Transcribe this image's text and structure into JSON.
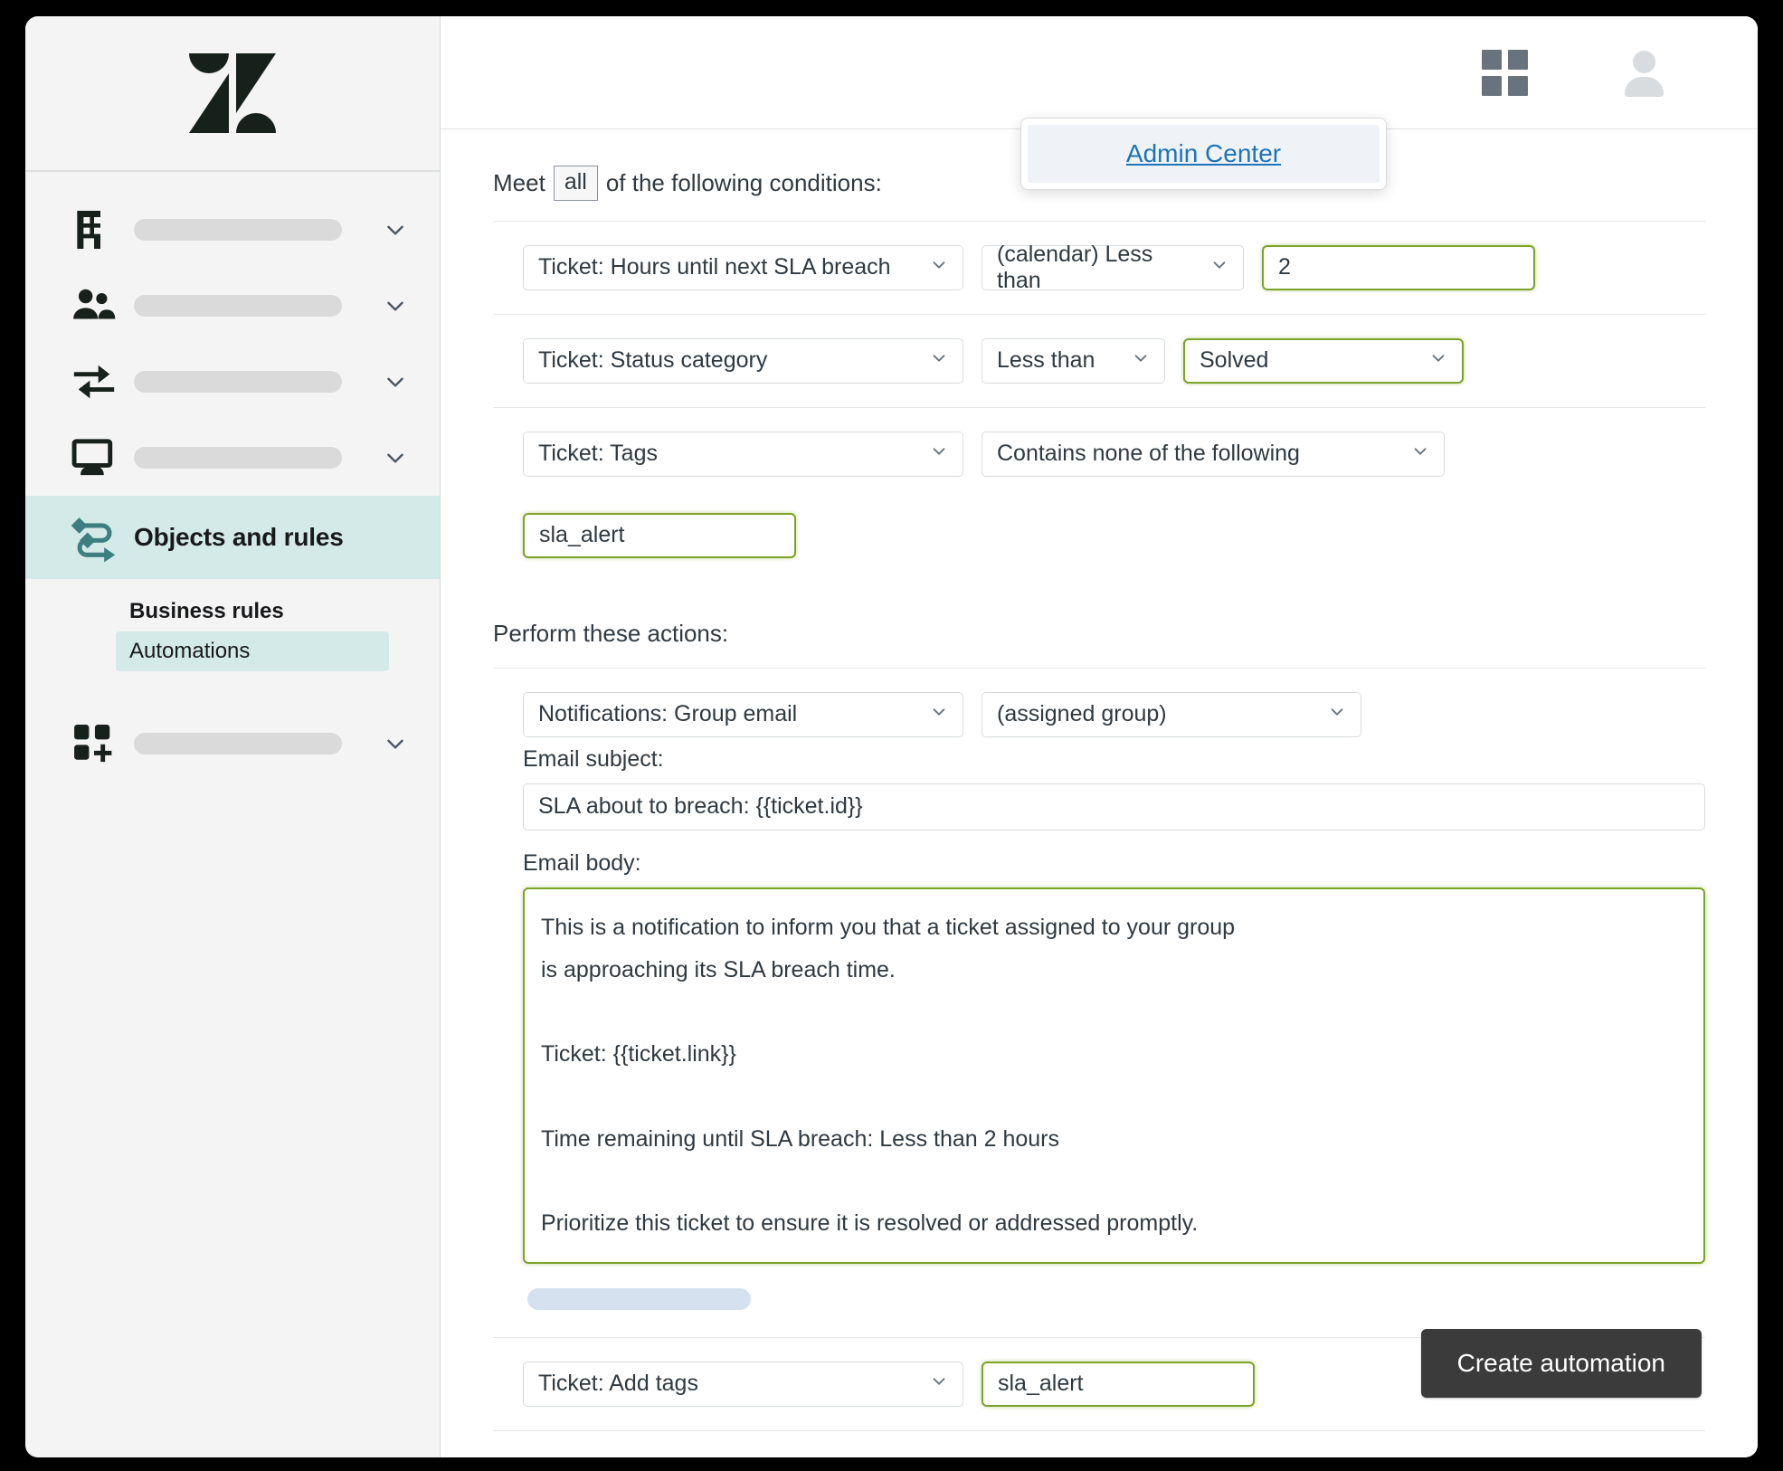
{
  "topbar": {
    "grid_icon": "grid-apps-icon",
    "avatar_icon": "user-avatar-icon",
    "dropdown": {
      "admin_center_label": "Admin Center"
    }
  },
  "sidebar": {
    "logo": "zendesk-logo",
    "items": [
      {
        "icon": "building-icon",
        "label": ""
      },
      {
        "icon": "people-icon",
        "label": ""
      },
      {
        "icon": "transfer-arrows-icon",
        "label": ""
      },
      {
        "icon": "monitor-icon",
        "label": ""
      }
    ],
    "active_item": {
      "icon": "objects-rules-icon",
      "label": "Objects and rules"
    },
    "sub_items": [
      {
        "label": "Business rules",
        "selected": false
      },
      {
        "label": "Automations",
        "selected": true
      }
    ],
    "bottom_item": {
      "icon": "apps-add-icon",
      "label": ""
    }
  },
  "main": {
    "conditions": {
      "heading_prefix": "Meet",
      "heading_chip": "all",
      "heading_suffix": "of the following conditions:",
      "rows": [
        {
          "field": "Ticket: Hours until next SLA breach",
          "operator": "(calendar) Less than",
          "value": "2"
        },
        {
          "field": "Ticket: Status category",
          "operator": "Less than",
          "value": "Solved"
        },
        {
          "field": "Ticket: Tags",
          "operator": "Contains none of the following",
          "value": "sla_alert"
        }
      ]
    },
    "actions": {
      "heading": "Perform these actions:",
      "notification": {
        "field": "Notifications: Group email",
        "target": "(assigned group)",
        "subject_label": "Email subject:",
        "subject_value": "SLA about to breach: {{ticket.id}}",
        "body_label": "Email body:",
        "body_value": "This is a notification to inform you that a ticket assigned to your group\nis approaching its SLA breach time.\n\nTicket: {{ticket.link}}\n\nTime remaining until SLA breach: Less than 2 hours\n\nPrioritize this ticket to ensure it is resolved or addressed promptly."
      },
      "add_tags": {
        "field": "Ticket: Add tags",
        "value": "sla_alert"
      }
    },
    "submit_label": "Create automation"
  },
  "colors": {
    "accent_teal": "#d3eae8",
    "focus_green": "#7ba428",
    "link_blue": "#1f73b7",
    "button_dark": "#3b3b3b"
  }
}
